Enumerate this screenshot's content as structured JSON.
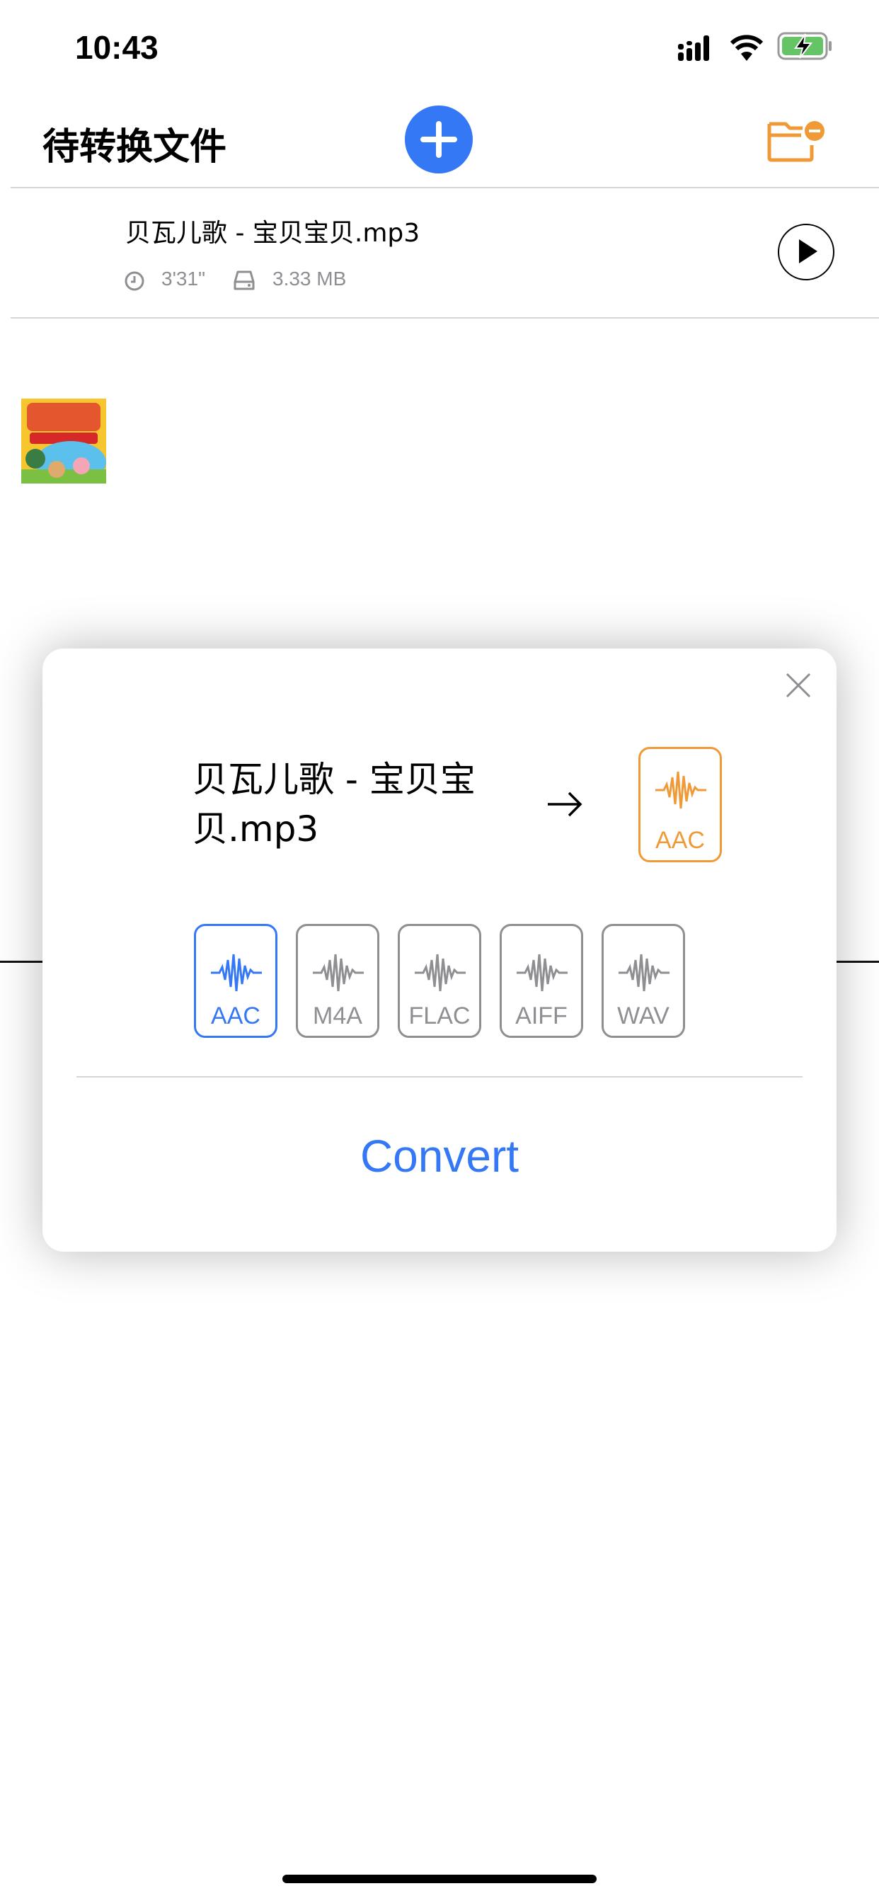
{
  "status_bar": {
    "time": "10:43",
    "icons": [
      "signal-icon",
      "wifi-icon",
      "battery-charging-icon"
    ]
  },
  "header": {
    "title": "待转换文件",
    "add_icon": "plus-circle-icon",
    "folder_icon": "folder-minus-icon"
  },
  "files": [
    {
      "name": "贝瓦儿歌 - 宝贝宝贝.mp3",
      "duration": "3'31\"",
      "size": "3.33 MB"
    }
  ],
  "dialog": {
    "file_name": "贝瓦儿歌 - 宝贝宝贝.mp3",
    "target_format": "AAC",
    "formats": [
      {
        "label": "AAC",
        "selected": true
      },
      {
        "label": "M4A",
        "selected": false
      },
      {
        "label": "FLAC",
        "selected": false
      },
      {
        "label": "AIFF",
        "selected": false
      },
      {
        "label": "WAV",
        "selected": false
      }
    ],
    "convert_label": "Convert"
  },
  "colors": {
    "accent": "#3478F6",
    "orange": "#F09A37",
    "gray": "#8E8E93",
    "battery": "#65C466"
  }
}
